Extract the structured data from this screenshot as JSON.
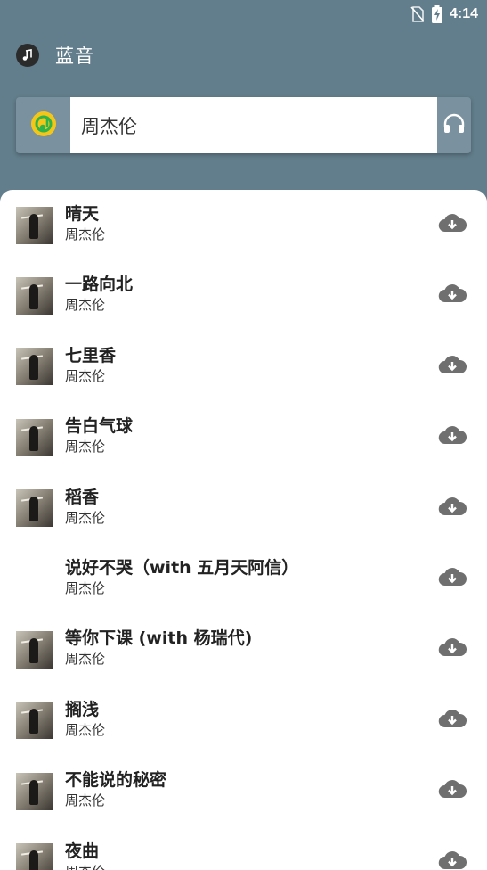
{
  "status_bar": {
    "time": "4:14",
    "icons": [
      "no-sim-icon",
      "battery-charging-icon"
    ]
  },
  "app": {
    "title": "蓝音",
    "logo_icon": "music-note-icon"
  },
  "search": {
    "value": "周杰伦",
    "placeholder": "",
    "source_icon": "qq-music-icon",
    "action_icon": "headphones-icon"
  },
  "colors": {
    "header_bg": "#627d8b",
    "accent_yellow": "#f5c518",
    "accent_green": "#2db34a",
    "download_icon": "#6f6f6f"
  },
  "songs": [
    {
      "title": "晴天",
      "artist": "周杰伦",
      "has_cover": true
    },
    {
      "title": "一路向北",
      "artist": "周杰伦",
      "has_cover": true
    },
    {
      "title": "七里香",
      "artist": "周杰伦",
      "has_cover": true
    },
    {
      "title": "告白气球",
      "artist": "周杰伦",
      "has_cover": true
    },
    {
      "title": "稻香",
      "artist": "周杰伦",
      "has_cover": true
    },
    {
      "title": "说好不哭（with 五月天阿信）",
      "artist": "周杰伦",
      "has_cover": false
    },
    {
      "title": "等你下课 (with 杨瑞代)",
      "artist": "周杰伦",
      "has_cover": true
    },
    {
      "title": "搁浅",
      "artist": "周杰伦",
      "has_cover": true
    },
    {
      "title": "不能说的秘密",
      "artist": "周杰伦",
      "has_cover": true
    },
    {
      "title": "夜曲",
      "artist": "周杰伦",
      "has_cover": true
    }
  ]
}
